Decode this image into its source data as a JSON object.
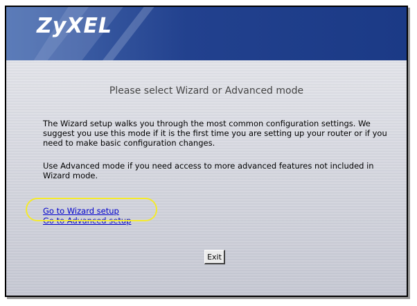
{
  "brand": {
    "logo_text": "ZyXEL",
    "header_color": "#1b3a86"
  },
  "main": {
    "title": "Please select Wizard or Advanced mode",
    "description_1": "The Wizard setup walks you through the most common configuration settings. We suggest you use this mode if it is the first time you are setting up your router or if you need to make basic configuration changes.",
    "description_2": "Use Advanced mode if you need access to more advanced features not included in Wizard mode.",
    "link_wizard": "Go to Wizard setup",
    "link_advanced": "Go to Advanced setup",
    "exit_label": "Exit"
  },
  "annotation": {
    "highlight_color": "#f4ea2c"
  }
}
